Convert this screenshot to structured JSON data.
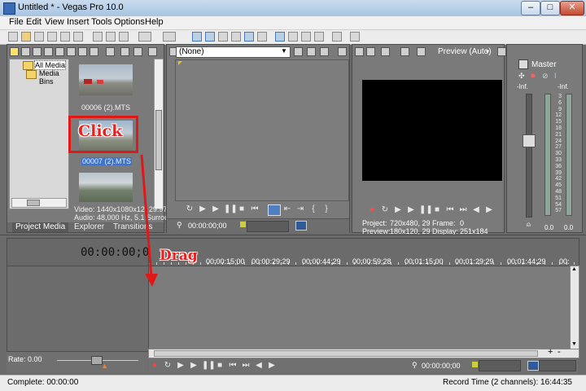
{
  "window": {
    "title": "Untitled * - Vegas Pro 10.0",
    "min": "–",
    "max": "□",
    "close": "✕"
  },
  "menu": [
    "File",
    "Edit",
    "View",
    "Insert",
    "Tools",
    "Options",
    "Help"
  ],
  "explorer": {
    "tree": [
      "All Media",
      "Media Bins"
    ],
    "thumbs": [
      {
        "label": "00006 (2).MTS"
      },
      {
        "label": "00007 (2).MTS",
        "selected": true
      },
      {
        "label": ""
      }
    ],
    "info": [
      "Video: 1440x1080x12, 29.97",
      "Audio: 48,000 Hz, 5.1 Surrou"
    ],
    "tabs": [
      "Project Media",
      "Explorer",
      "Transitions"
    ]
  },
  "trimmer": {
    "dropdown": "(None)",
    "timecode": "00:00:00;00"
  },
  "preview": {
    "quality": "Preview (Auto)",
    "project_label": "Project:",
    "project_value": "720x480, 29",
    "preview_label": "Preview:",
    "preview_value": "180x120, 29",
    "frame_label": "Frame:",
    "frame_value": "0",
    "display_label": "Display:",
    "display_value": "251x184"
  },
  "master": {
    "title": "Master",
    "inf_left": "-Inf.",
    "inf_right": "-Inf.",
    "scale": [
      "3",
      "6",
      "9",
      "12",
      "15",
      "18",
      "21",
      "24",
      "27",
      "30",
      "33",
      "36",
      "39",
      "42",
      "45",
      "48",
      "51",
      "54",
      "57"
    ],
    "bottom_left": "0.0",
    "bottom_right": "0.0"
  },
  "timeline": {
    "cursor_time": "00:00:00;00",
    "ruler": [
      "00:00:15;00",
      "00:00:29;29",
      "00:00:44;29",
      "00:00:59;28",
      "00:01:15;00",
      "00:01:29;29",
      "00:01:44;29",
      "00:"
    ],
    "rate": "Rate: 0.00",
    "transport_time": "00:00:00;00",
    "zoom_plus": "+",
    "zoom_minus": "-"
  },
  "status": {
    "left": "Complete: 00:00:00",
    "right": "Record Time (2 channels): 16:44:35"
  },
  "annotations": {
    "click": "Click",
    "drag": "Drag"
  },
  "colors": {
    "annotation_red": "#e01818",
    "selection_blue": "#3f73c8"
  }
}
